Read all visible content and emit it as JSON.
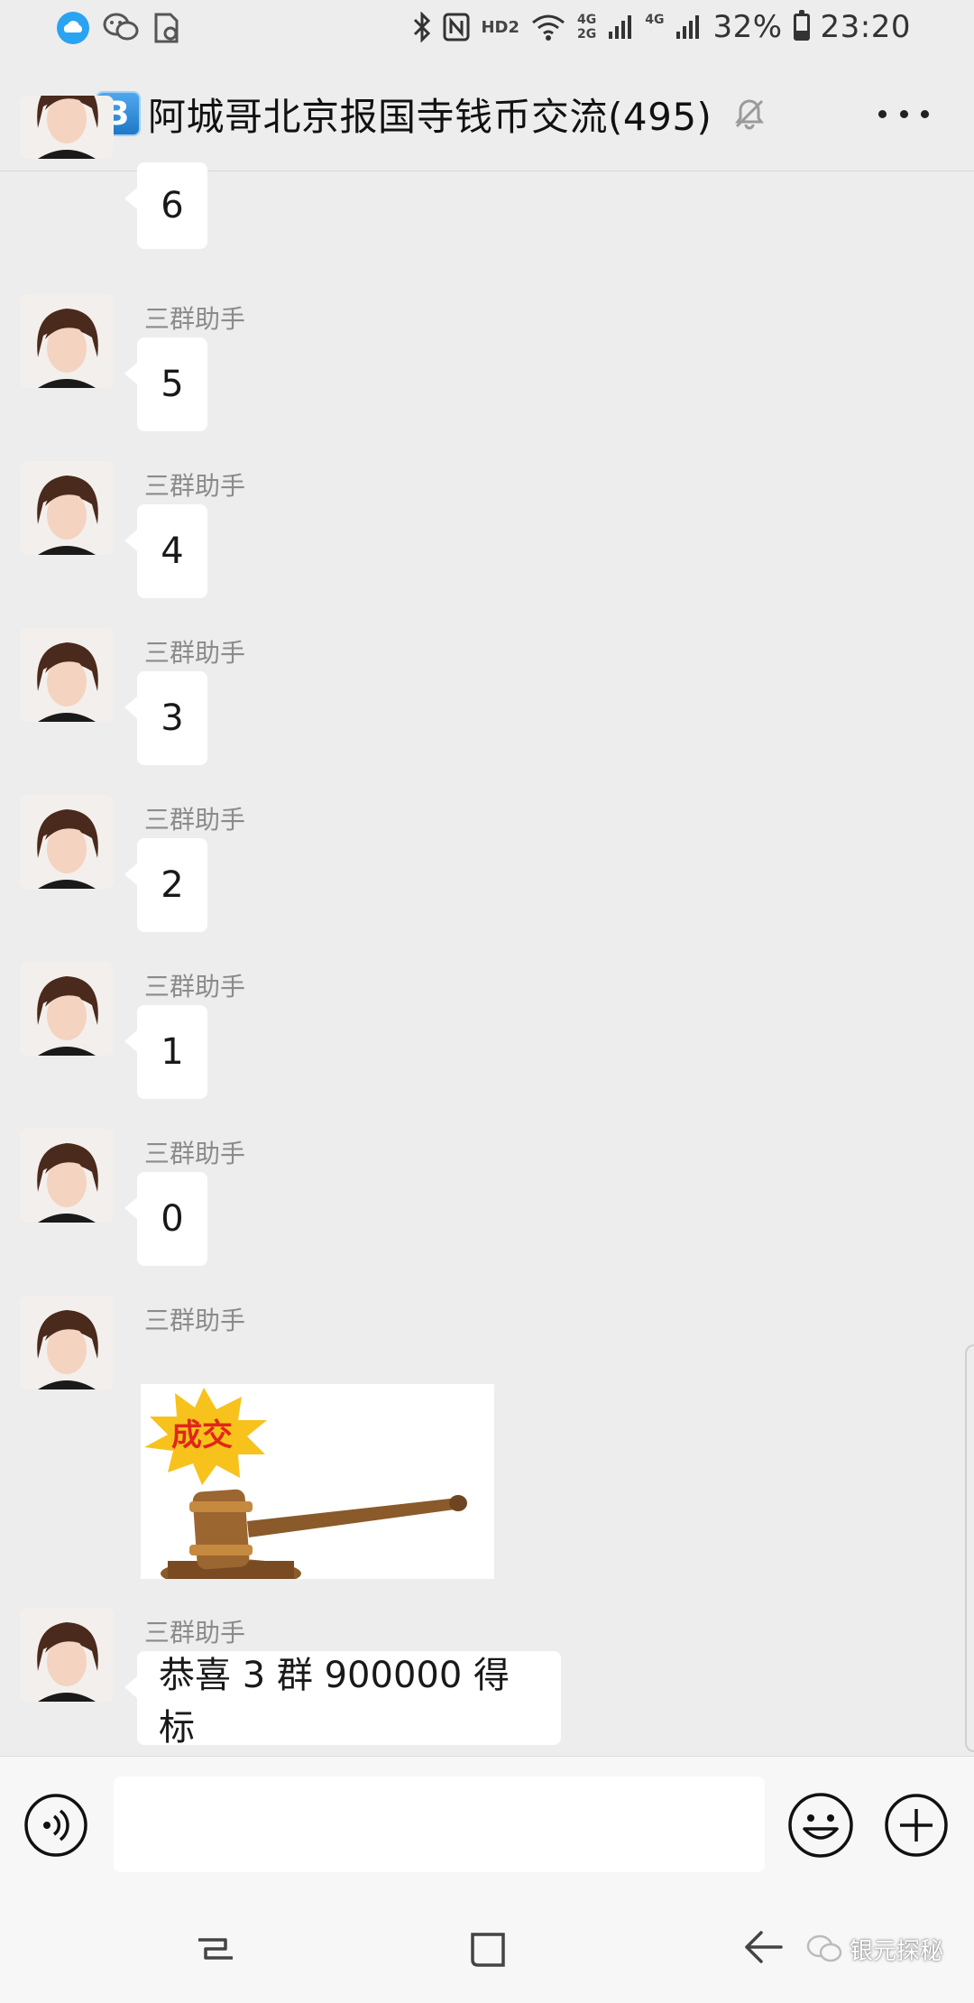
{
  "status_bar": {
    "network_hd": "HD2",
    "net_4g_top": "4G",
    "net_2g_bottom": "2G",
    "net_4g_second": "4G",
    "battery_percent": "32%",
    "battery_level": 0.32,
    "time": "23:20",
    "icons": [
      "cloud-icon",
      "wechat-icon",
      "file-icon",
      "bluetooth-icon",
      "nfc-icon",
      "wifi-icon",
      "signal-icon",
      "battery-icon"
    ]
  },
  "header": {
    "group_number_badge": "3",
    "title": "阿城哥北京报国寺钱币交流(495)",
    "muted": true
  },
  "messages": [
    {
      "sender": "",
      "text": "6"
    },
    {
      "sender": "三群助手",
      "text": "5"
    },
    {
      "sender": "三群助手",
      "text": "4"
    },
    {
      "sender": "三群助手",
      "text": "3"
    },
    {
      "sender": "三群助手",
      "text": "2"
    },
    {
      "sender": "三群助手",
      "text": "1"
    },
    {
      "sender": "三群助手",
      "text": "0"
    },
    {
      "sender": "三群助手",
      "image_caption": "成交"
    },
    {
      "sender": "三群助手",
      "text": "恭喜 3 群 900000 得标"
    }
  ],
  "input_bar": {
    "placeholder": ""
  },
  "watermark": {
    "text": "银元探秘"
  },
  "colors": {
    "background": "#ededed",
    "bubble": "#ffffff",
    "sender_name": "#8b8b8b",
    "badge_blue": "#1f78c8",
    "starburst": "#f7c21c",
    "stamp_red": "#e0261b",
    "gavel_brown": "#8a5a2b"
  }
}
